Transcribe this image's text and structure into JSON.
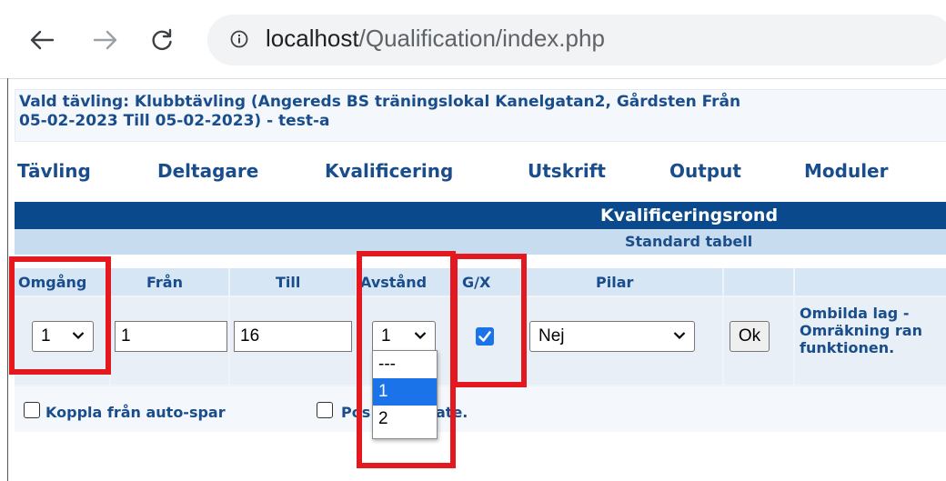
{
  "browser": {
    "url_host": "localhost",
    "url_path": "/Qualification/index.php"
  },
  "competition": {
    "title_line1": "Vald tävling: Klubbtävling (Angereds BS träningslokal Kanelgatan2, Gårdsten Från",
    "title_line2": "05-02-2023 Till 05-02-2023) - test-a"
  },
  "menu": [
    "Tävling",
    "Deltagare",
    "Kvalificering",
    "Utskrift",
    "Output",
    "Moduler"
  ],
  "table": {
    "header": "Kvalificeringsrond",
    "subheader": "Standard tabell",
    "columns": [
      "Omgång",
      "Från",
      "Till",
      "Avstånd",
      "G/X",
      "Pilar"
    ],
    "row": {
      "omgang": "1",
      "fran": "1",
      "till": "16",
      "avstand": "1",
      "gx_checked": true,
      "pilar": "Nej",
      "ok_label": "Ok",
      "note": "Ombilda lag -\nOmräkning ran\nfunktionen."
    },
    "avstand_options": [
      "---",
      "1",
      "2"
    ],
    "avstand_selected_option": "1"
  },
  "bottom": {
    "autosave_label": "Koppla från auto-spar",
    "second_label_start": "Pos",
    "second_label_end": "ate."
  },
  "colors": {
    "accent": "#1a4d8c",
    "header_dark": "#0a4a8c",
    "highlight": "#e3191f",
    "checkbox": "#1a73e8"
  }
}
